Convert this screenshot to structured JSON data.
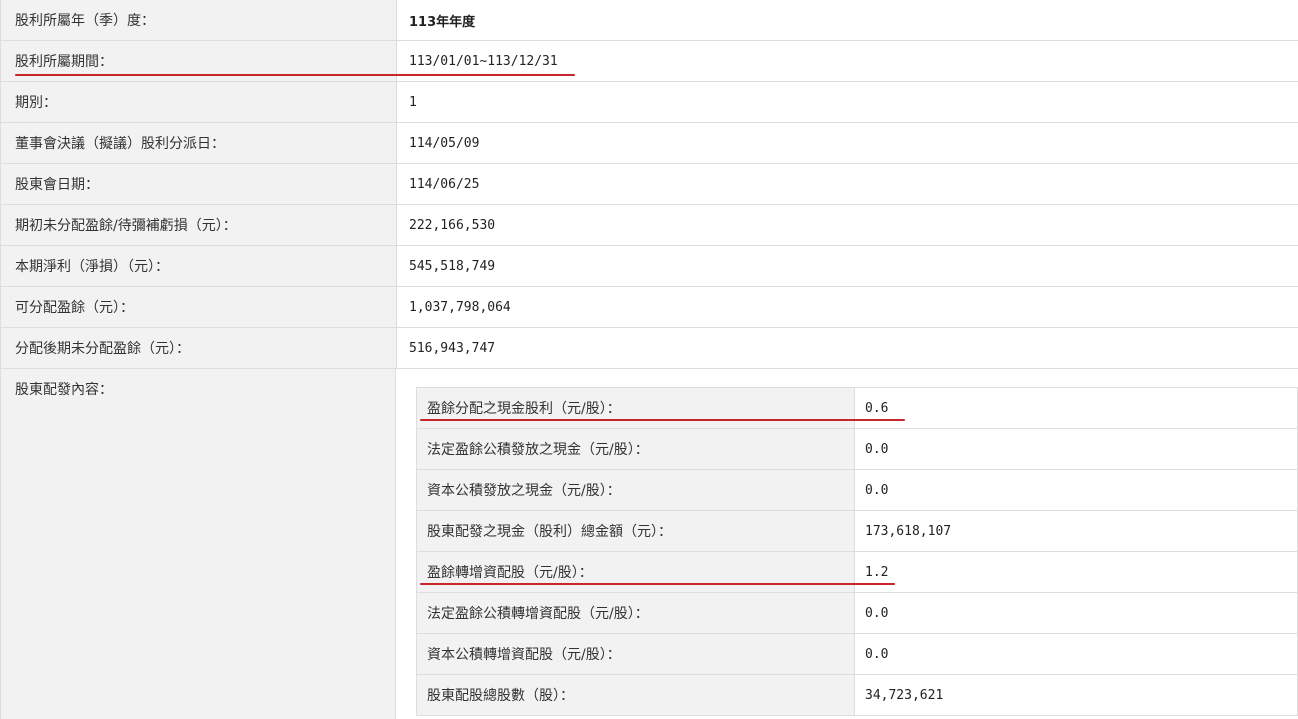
{
  "rows": [
    {
      "label": "股利所屬年（季）度：",
      "value": "113年年度"
    },
    {
      "label": "股利所屬期間：",
      "value": "113/01/01~113/12/31"
    },
    {
      "label": "期別：",
      "value": "1"
    },
    {
      "label": "董事會決議（擬議）股利分派日：",
      "value": "114/05/09"
    },
    {
      "label": "股東會日期：",
      "value": "114/06/25"
    },
    {
      "label": "期初未分配盈餘/待彌補虧損（元）：",
      "value": "222,166,530"
    },
    {
      "label": "本期淨利（淨損）（元）：",
      "value": "545,518,749"
    },
    {
      "label": "可分配盈餘（元）：",
      "value": "1,037,798,064"
    },
    {
      "label": "分配後期未分配盈餘（元）：",
      "value": "516,943,747"
    }
  ],
  "distribution": {
    "label": "股東配發內容：",
    "items": [
      {
        "label": "盈餘分配之現金股利（元/股）：",
        "value": "0.6"
      },
      {
        "label": "法定盈餘公積發放之現金（元/股）：",
        "value": "0.0"
      },
      {
        "label": "資本公積發放之現金（元/股）：",
        "value": "0.0"
      },
      {
        "label": "股東配發之現金（股利）總金額（元）：",
        "value": "173,618,107"
      },
      {
        "label": "盈餘轉增資配股（元/股）：",
        "value": "1.2"
      },
      {
        "label": "法定盈餘公積轉增資配股（元/股）：",
        "value": "0.0"
      },
      {
        "label": "資本公積轉增資配股（元/股）：",
        "value": "0.0"
      },
      {
        "label": "股東配股總股數（股）：",
        "value": "34,723,621"
      }
    ]
  },
  "colors": {
    "underline": "#c8252c",
    "label_bg": "#f2f2f2",
    "border": "#dddddd"
  }
}
